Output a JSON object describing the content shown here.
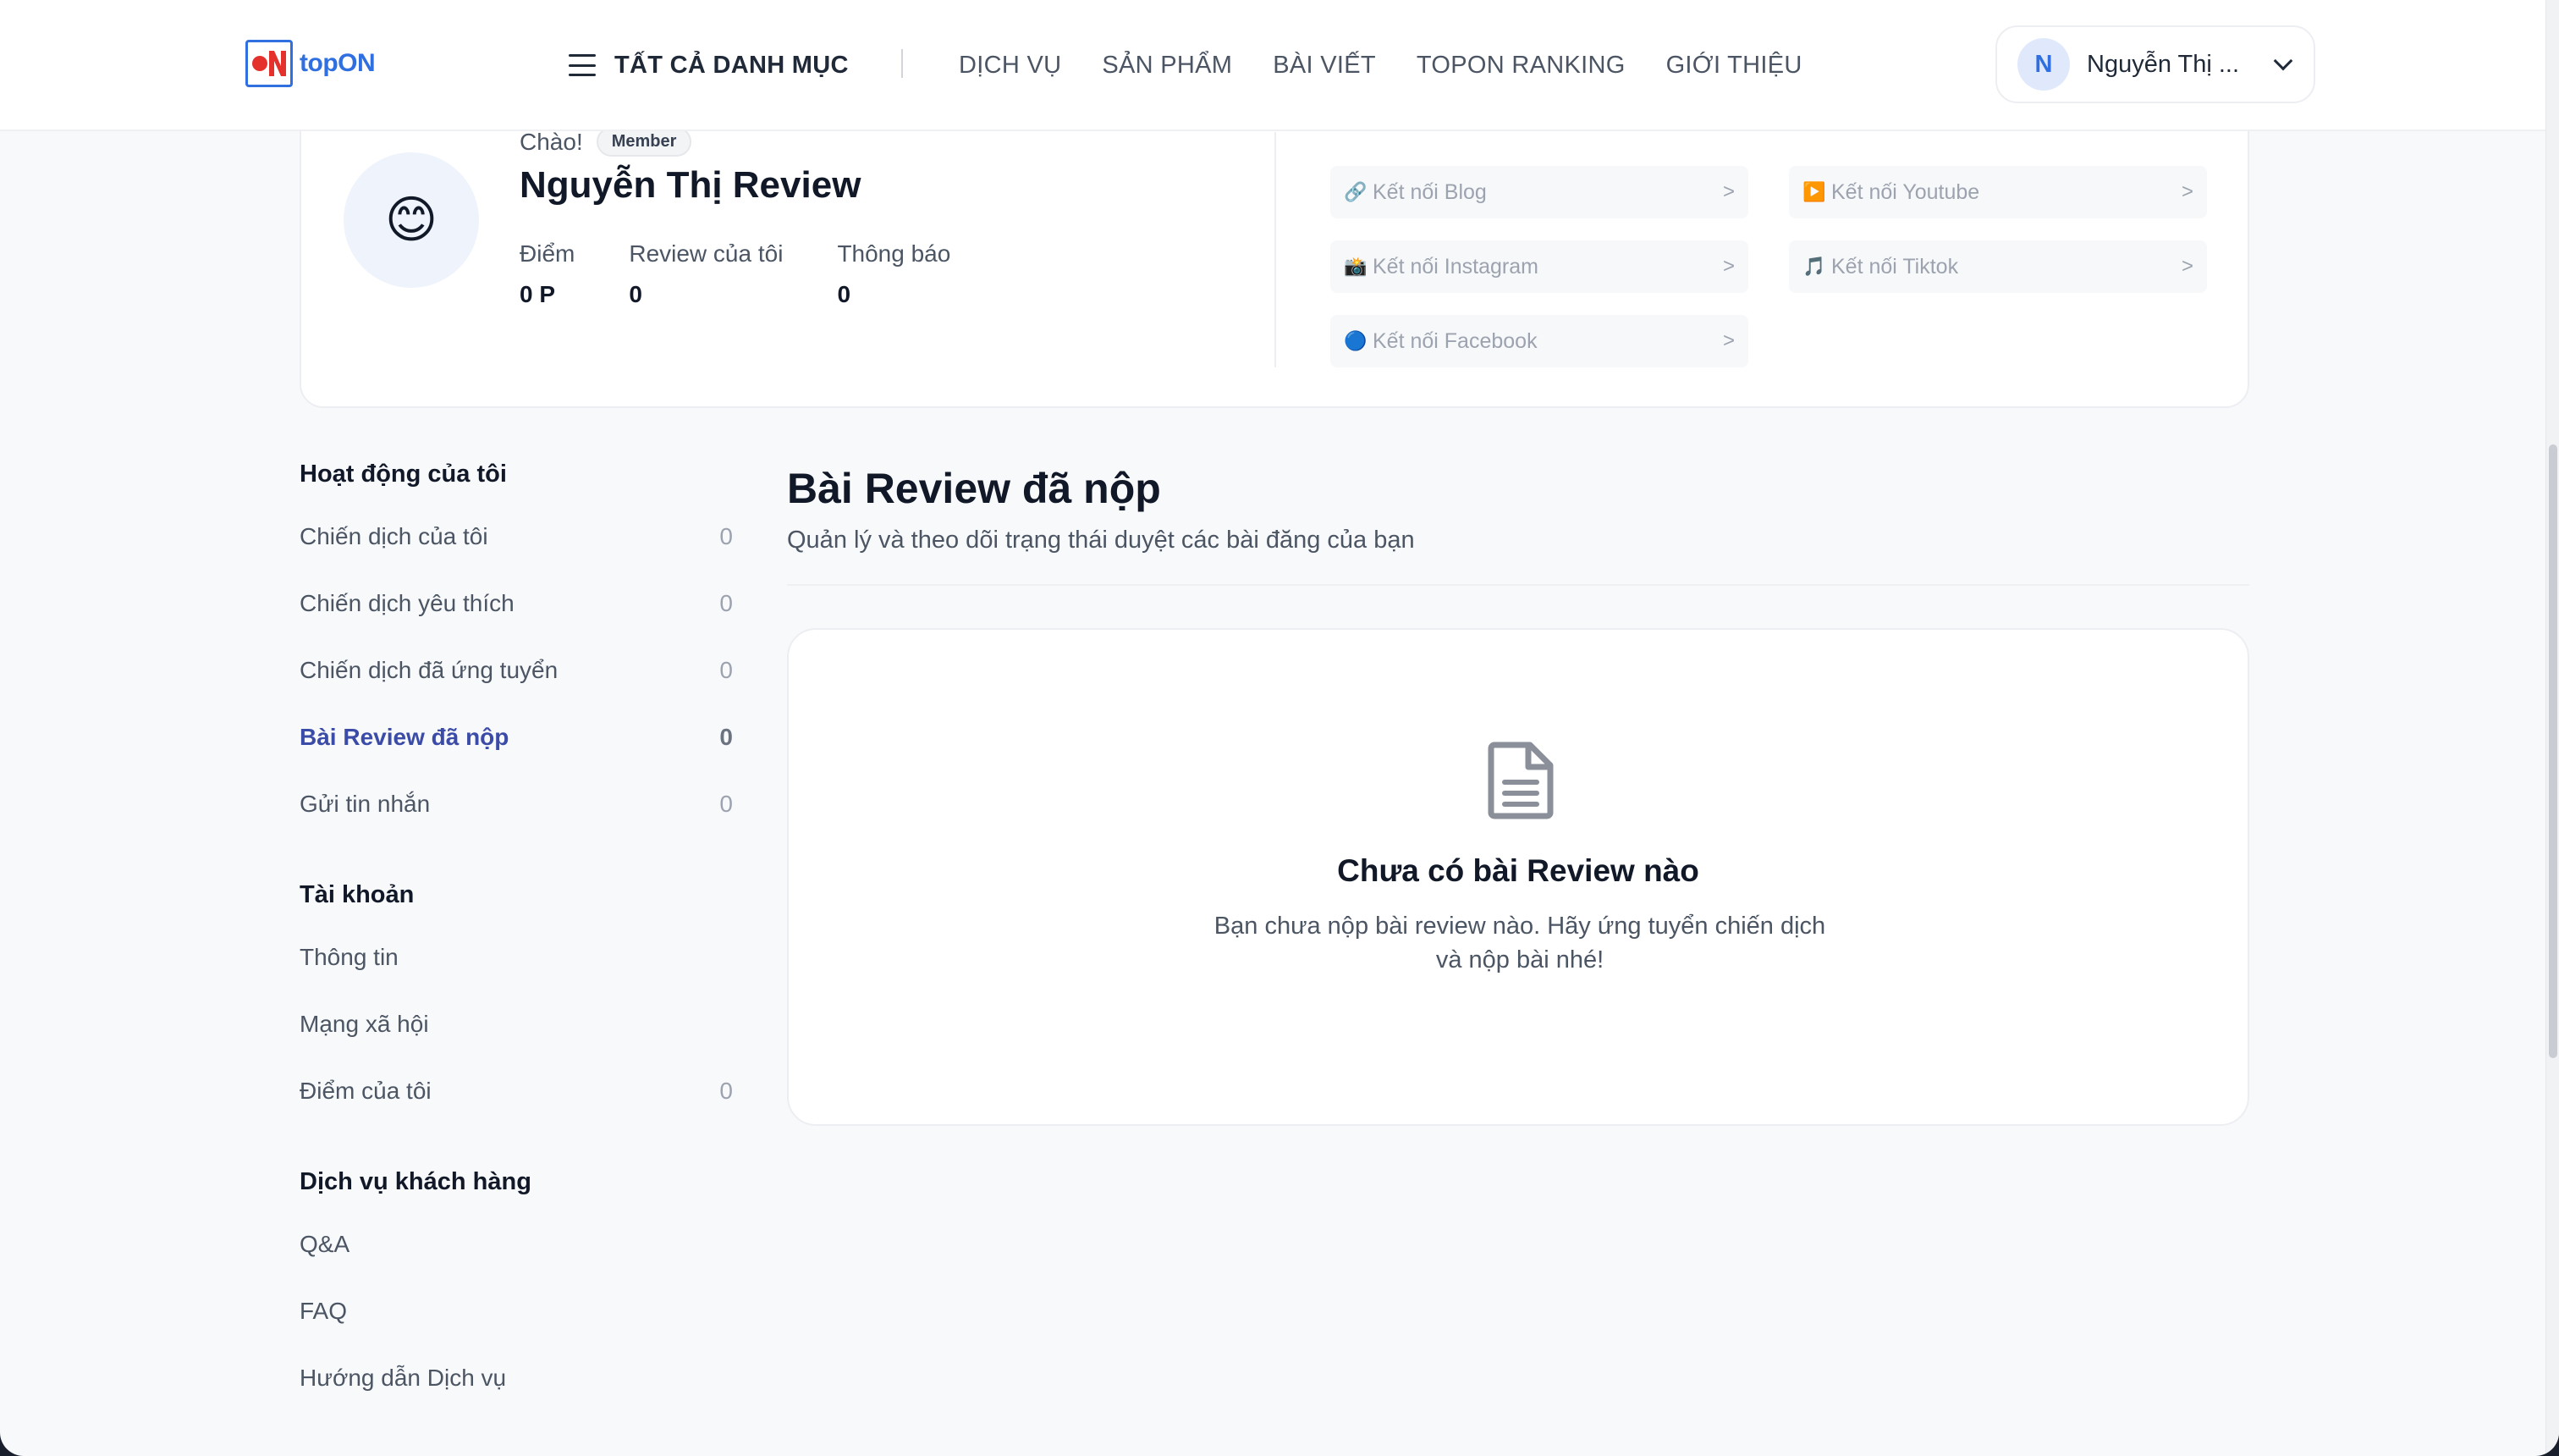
{
  "header": {
    "logo_text": "topON",
    "all_categories_label": "TẤT CẢ DANH MỤC",
    "nav": [
      "DỊCH VỤ",
      "SẢN PHẨM",
      "BÀI VIẾT",
      "TOPON RANKING",
      "GIỚI THIỆU"
    ],
    "user_initial": "N",
    "user_name": "Nguyễn Thị ..."
  },
  "profile": {
    "greeting": "Chào!",
    "badge": "Member",
    "name": "Nguyễn Thị Review",
    "avatar_emoji": "😊",
    "stats": [
      {
        "label": "Điểm",
        "value": "0 P"
      },
      {
        "label": "Review của tôi",
        "value": "0"
      },
      {
        "label": "Thông báo",
        "value": "0"
      }
    ],
    "connections": [
      {
        "icon": "🔗",
        "label": "Kết nối Blog",
        "arrow": ">"
      },
      {
        "icon": "▶️",
        "label": "Kết nối Youtube",
        "arrow": ">"
      },
      {
        "icon": "📸",
        "label": "Kết nối Instagram",
        "arrow": ">"
      },
      {
        "icon": "🎵",
        "label": "Kết nối Tiktok",
        "arrow": ">"
      },
      {
        "icon": "🔵",
        "label": "Kết nối Facebook",
        "arrow": ">"
      }
    ]
  },
  "sidebar": {
    "groups": [
      {
        "title": "Hoạt động của tôi",
        "items": [
          {
            "label": "Chiến dịch của tôi",
            "count": "0"
          },
          {
            "label": "Chiến dịch yêu thích",
            "count": "0"
          },
          {
            "label": "Chiến dịch đã ứng tuyển",
            "count": "0"
          },
          {
            "label": "Bài Review đã nộp",
            "count": "0",
            "active": true
          },
          {
            "label": "Gửi tin nhắn",
            "count": "0"
          }
        ]
      },
      {
        "title": "Tài khoản",
        "items": [
          {
            "label": "Thông tin",
            "count": ""
          },
          {
            "label": "Mạng xã hội",
            "count": ""
          },
          {
            "label": "Điểm của tôi",
            "count": "0"
          }
        ]
      },
      {
        "title": "Dịch vụ khách hàng",
        "items": [
          {
            "label": "Q&A",
            "count": ""
          },
          {
            "label": "FAQ",
            "count": ""
          },
          {
            "label": "Hướng dẫn Dịch vụ",
            "count": ""
          }
        ]
      }
    ]
  },
  "main": {
    "title": "Bài Review đã nộp",
    "subtitle": "Quản lý và theo dõi trạng thái duyệt các bài đăng của bạn",
    "empty": {
      "icon": "document-icon",
      "title": "Chưa có bài Review nào",
      "text": "Bạn chưa nộp bài review nào. Hãy ứng tuyển chiến dịch và nộp bài nhé!"
    }
  },
  "colors": {
    "brand": "#2f6fe0",
    "brand_red": "#e5312b",
    "active_nav": "#3b4ba8"
  }
}
